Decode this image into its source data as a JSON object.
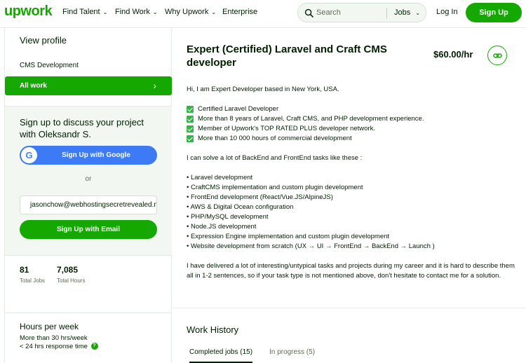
{
  "header": {
    "logo": "upwork",
    "nav": [
      {
        "label": "Find Talent",
        "has_dropdown": true
      },
      {
        "label": "Find Work",
        "has_dropdown": true
      },
      {
        "label": "Why Upwork",
        "has_dropdown": true
      },
      {
        "label": "Enterprise",
        "has_dropdown": false
      }
    ],
    "search_placeholder": "Search",
    "search_scope": "Jobs",
    "login": "Log In",
    "signup": "Sign Up"
  },
  "sidebar": {
    "view_profile": "View profile",
    "specialization": "CMS Development",
    "all_work": "All work",
    "signup_box": {
      "title": "Sign up to discuss your project with Oleksandr S.",
      "google_button": "Sign Up with Google",
      "google_letter": "G",
      "or": "or",
      "email_value": "jasonchow@webhostingsecretrevealed.net",
      "email_button": "Sign Up with Email"
    },
    "stats": [
      {
        "value": "81",
        "label": "Total Jobs"
      },
      {
        "value": "7,085",
        "label": "Total Hours"
      }
    ],
    "hours_per_week": {
      "title": "Hours per week",
      "availability": "More than 30 hrs/week",
      "response": "< 24 hrs response time",
      "help_icon_text": "?"
    }
  },
  "main": {
    "title": "Expert (Certified) Laravel and Craft CMS developer",
    "rate": "$60.00/hr",
    "intro": "Hi, I am Expert Developer based in New York, USA.",
    "checklist": [
      "Certified Laravel Developer",
      "More than 8 years of Laravel, Craft CMS, and PHP development experience.",
      "Member of Upwork's TOP RATED PLUS developer network.",
      "More than 10 000 hours of commercial development"
    ],
    "tasks_intro": "I can solve a lot of BackEnd and FrontEnd tasks like these :",
    "tasks": [
      "• Laravel development",
      "• CraftCMS implementation and custom plugin development",
      "• FrontEnd development (React/Vue.JS/AlpineJS)",
      "• AWS & Digital Ocean configuration",
      "• PHP/MySQL development",
      "• Node.JS development",
      "• Expression Engine implementation and custom plugin development",
      "• Website development from scratch (UX → UI → FrontEnd → BackEnd → Launch )"
    ],
    "closing": "I have delivered a lot of interesting/untypical tasks and projects during my career and it is hard to describe them all in 1-2 sentences, so if your task type is not mentioned above, don't hesitate to contact me for a solution.",
    "work_history": {
      "title": "Work History",
      "tabs": [
        {
          "label": "Completed jobs (15)",
          "active": true
        },
        {
          "label": "In progress (5)",
          "active": false
        }
      ]
    }
  },
  "colors": {
    "brand_green": "#14a800",
    "google_blue": "#3c7bf5",
    "check_green": "#36b24a"
  }
}
